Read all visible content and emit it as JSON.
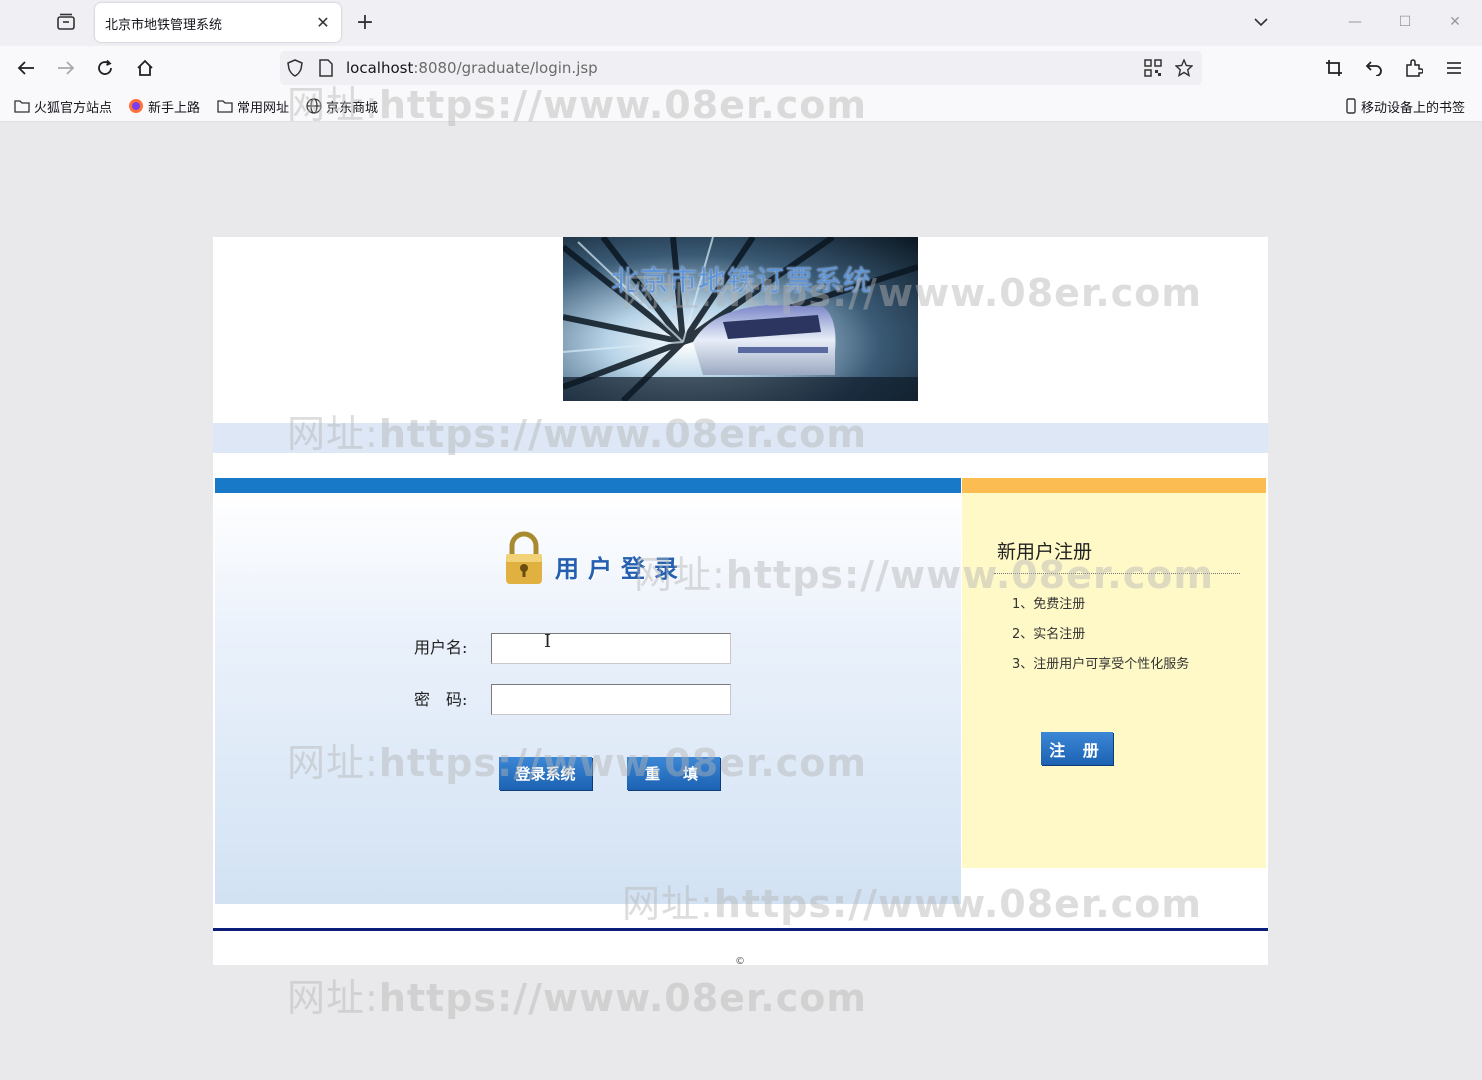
{
  "browser": {
    "tab_title": "北京市地铁管理系统",
    "url_host": "localhost",
    "url_rest": ":8080/graduate/login.jsp",
    "bookmarks": [
      "火狐官方站点",
      "新手上路",
      "常用网址",
      "京东商城"
    ],
    "mobile_bookmarks": "移动设备上的书签"
  },
  "banner": {
    "title": "北京市地铁订票系统"
  },
  "login": {
    "title": "用户登录",
    "username_label": "用户名:",
    "password_label": "密　码:",
    "username_value": "",
    "password_value": "",
    "submit_label": "登录系统",
    "reset_label": "重　填"
  },
  "register": {
    "title": "新用户注册",
    "items": [
      "1、免费注册",
      "2、实名注册",
      "3、注册用户可享受个性化服务"
    ],
    "button_label": "注 册"
  },
  "footer": {
    "copyright": "©"
  },
  "watermark": {
    "prefix": "网址:",
    "text": "https://www.08er.com"
  },
  "colors": {
    "login_top_bar": "#1979c9",
    "register_top_bar": "#fbbd52",
    "register_bg": "#fff9c8",
    "button": "#2a72c4",
    "footer_line": "#0b1f7a"
  }
}
